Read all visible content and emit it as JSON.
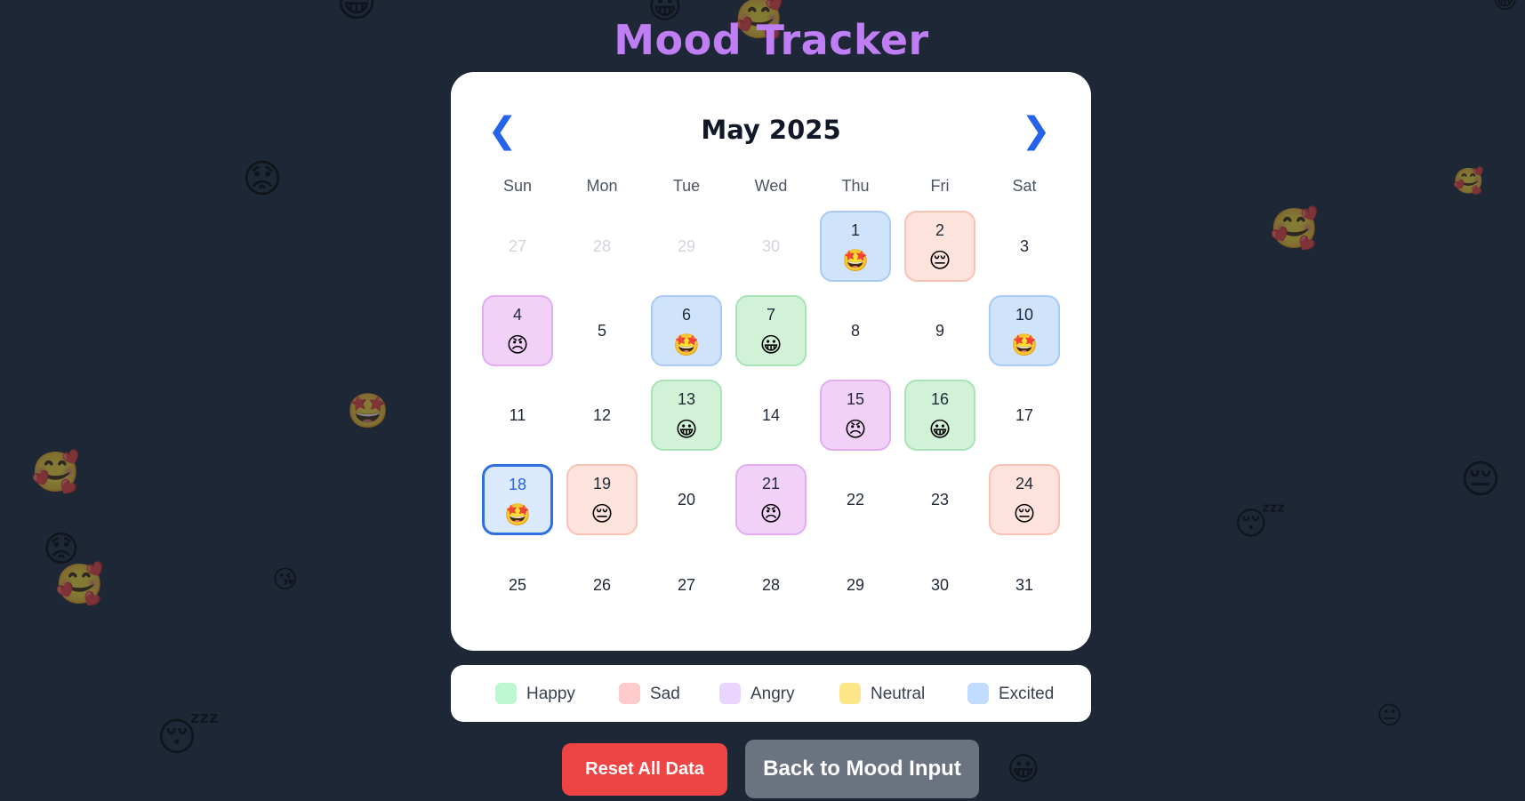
{
  "app": {
    "title": "Mood Tracker"
  },
  "calendar": {
    "month_label": "May 2025",
    "prev_icon": "❮",
    "next_icon": "❯",
    "weekdays": [
      "Sun",
      "Mon",
      "Tue",
      "Wed",
      "Thu",
      "Fri",
      "Sat"
    ],
    "days": [
      {
        "day": "27",
        "other": true
      },
      {
        "day": "28",
        "other": true
      },
      {
        "day": "29",
        "other": true
      },
      {
        "day": "30",
        "other": true
      },
      {
        "day": "1",
        "mood": "excited"
      },
      {
        "day": "2",
        "mood": "sad"
      },
      {
        "day": "3"
      },
      {
        "day": "4",
        "mood": "angry"
      },
      {
        "day": "5"
      },
      {
        "day": "6",
        "mood": "excited"
      },
      {
        "day": "7",
        "mood": "happy"
      },
      {
        "day": "8"
      },
      {
        "day": "9"
      },
      {
        "day": "10",
        "mood": "excited"
      },
      {
        "day": "11"
      },
      {
        "day": "12"
      },
      {
        "day": "13",
        "mood": "happy"
      },
      {
        "day": "14"
      },
      {
        "day": "15",
        "mood": "angry"
      },
      {
        "day": "16",
        "mood": "happy"
      },
      {
        "day": "17"
      },
      {
        "day": "18",
        "mood": "excited",
        "today": true
      },
      {
        "day": "19",
        "mood": "sad"
      },
      {
        "day": "20"
      },
      {
        "day": "21",
        "mood": "angry"
      },
      {
        "day": "22"
      },
      {
        "day": "23"
      },
      {
        "day": "24",
        "mood": "sad"
      },
      {
        "day": "25"
      },
      {
        "day": "26"
      },
      {
        "day": "27"
      },
      {
        "day": "28"
      },
      {
        "day": "29"
      },
      {
        "day": "30"
      },
      {
        "day": "31"
      }
    ]
  },
  "moods": {
    "happy": {
      "label": "Happy",
      "emoji": "😀",
      "icon": "grinning-face-icon",
      "color": "#bbf7d0"
    },
    "sad": {
      "label": "Sad",
      "emoji": "😔",
      "icon": "pensive-face-icon",
      "color": "#fecaca"
    },
    "angry": {
      "label": "Angry",
      "emoji": "😠",
      "icon": "angry-face-icon",
      "color": "#e9d5ff"
    },
    "neutral": {
      "label": "Neutral",
      "emoji": "😐",
      "icon": "neutral-face-icon",
      "color": "#fde68a"
    },
    "excited": {
      "label": "Excited",
      "emoji": "🤩",
      "icon": "star-struck-face-icon",
      "color": "#bfdbfe"
    }
  },
  "legend": {
    "items": [
      {
        "key": "happy",
        "label": "Happy",
        "color": "#bbf7d0"
      },
      {
        "key": "sad",
        "label": "Sad",
        "color": "#fecaca"
      },
      {
        "key": "angry",
        "label": "Angry",
        "color": "#e9d5ff"
      },
      {
        "key": "neutral",
        "label": "Neutral",
        "color": "#fde68a"
      },
      {
        "key": "excited",
        "label": "Excited",
        "color": "#bfdbfe"
      }
    ]
  },
  "buttons": {
    "reset_label": "Reset All Data",
    "back_label": "Back to Mood Input"
  },
  "background_emojis": [
    "😀",
    "😀",
    "🥰",
    "😀",
    "😟",
    "🥰",
    "🥰",
    "🤩",
    "🥰",
    "😔",
    "😴",
    "😟",
    "🥰",
    "😘",
    "😴",
    "😐",
    "😀"
  ]
}
